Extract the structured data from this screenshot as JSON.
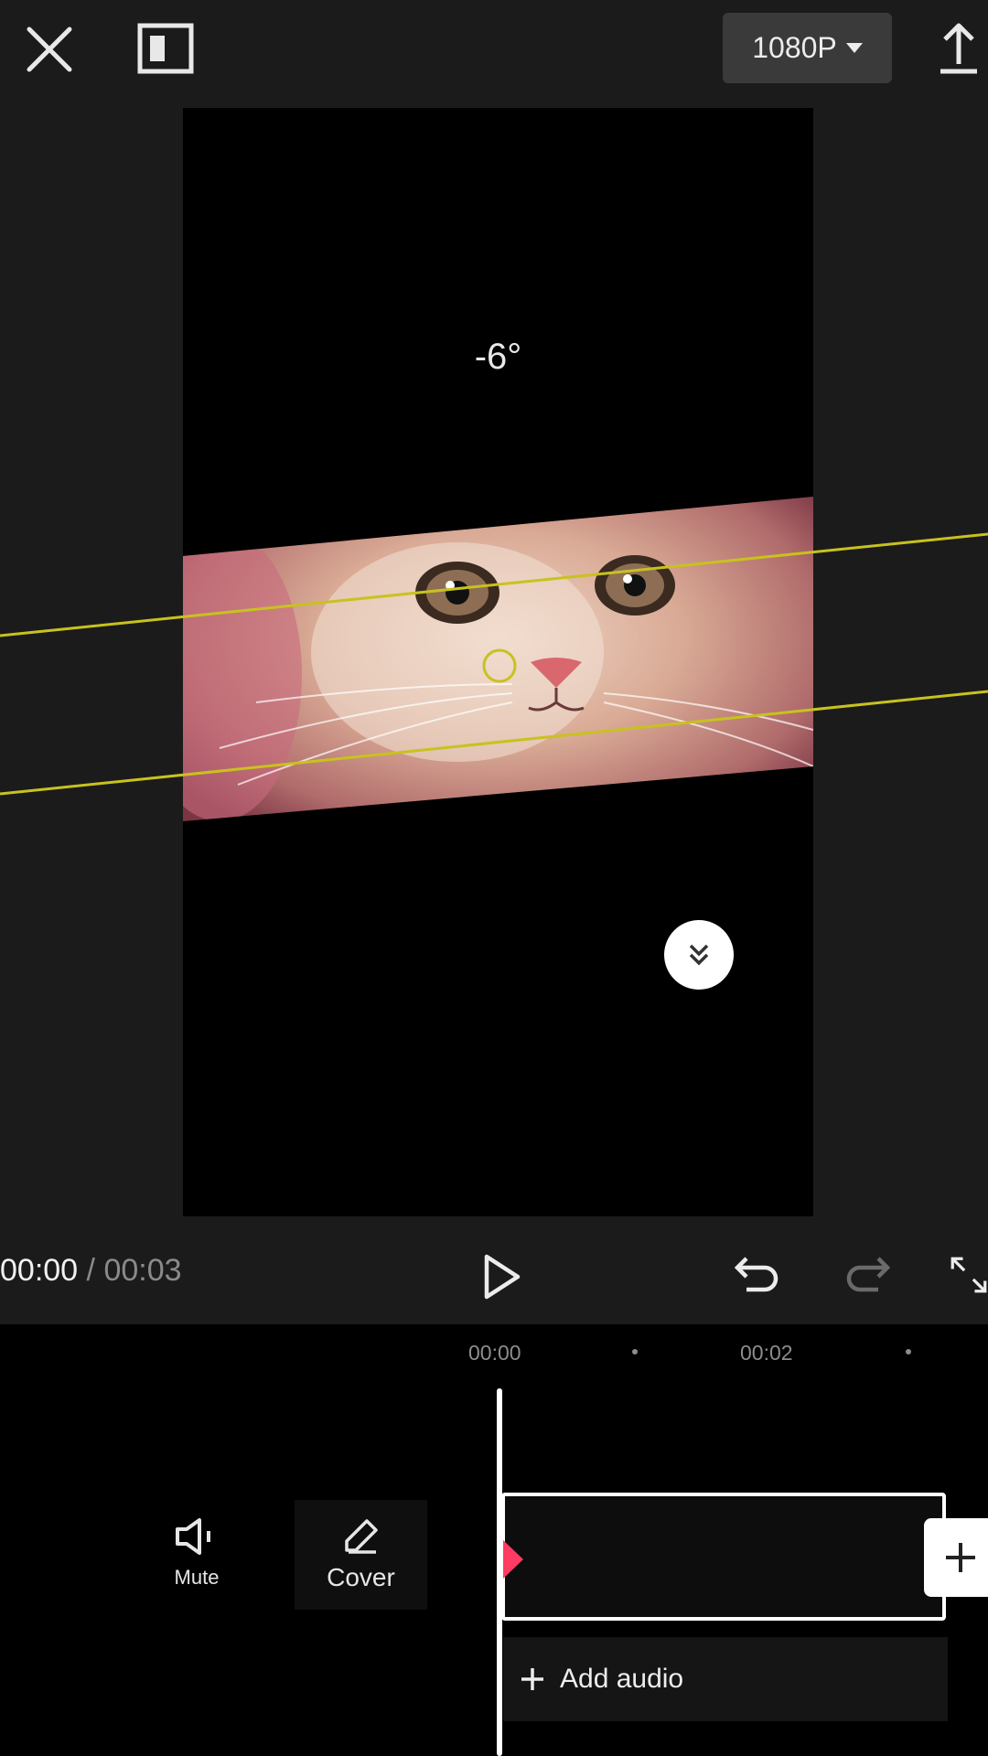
{
  "topbar": {
    "close_icon": "close-icon",
    "layout_icon": "layout-toggle-icon",
    "resolution_label": "1080P",
    "export_icon": "export-upload-icon"
  },
  "preview": {
    "rotation_label": "-6°",
    "collapse_icon": "double-chevron-down-icon"
  },
  "playback": {
    "current_time": "00:00",
    "separator": " / ",
    "total_time": "00:03",
    "play_icon": "play-icon",
    "undo_icon": "undo-icon",
    "redo_icon": "redo-icon",
    "fullscreen_icon": "fullscreen-icon"
  },
  "timeline": {
    "ticks": [
      "00:00",
      "00:02"
    ],
    "tools": {
      "mute_label": "Mute",
      "cover_label": "Cover"
    },
    "add_audio_label": "Add audio",
    "keyframe_color": "#ff3b63"
  },
  "colors": {
    "background": "#1b1b1b",
    "timeline_bg": "#000000",
    "guide_lines": "#c8c21e"
  }
}
